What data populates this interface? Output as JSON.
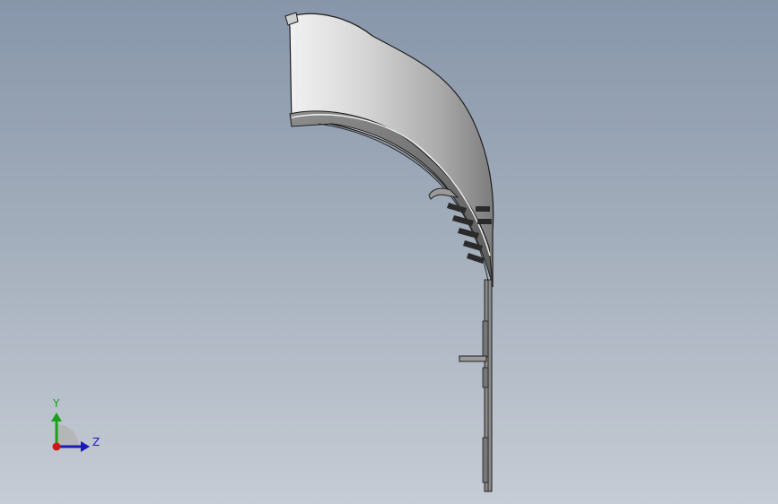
{
  "viewport": {
    "background_top": "#8796aa",
    "background_bottom": "#c6ccd5"
  },
  "model": {
    "face_color_light": "#e4e4e4",
    "face_color_dark": "#7b7b7b",
    "edge_color": "#1e1e1e"
  },
  "triad": {
    "y_label": "Y",
    "z_label": "Z",
    "y_color": "#1aa01a",
    "z_color": "#1a1ab4",
    "x_color": "#d01818"
  }
}
